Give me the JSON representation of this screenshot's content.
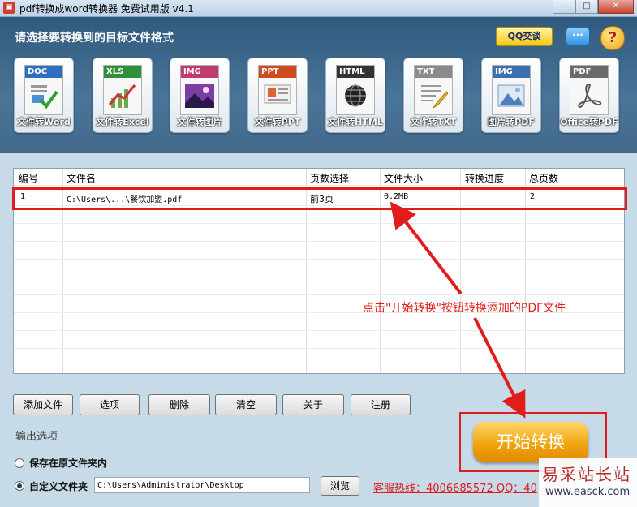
{
  "window": {
    "title": "pdf转换成word转换器 免费试用版 v4.1",
    "controls": [
      "—",
      "□",
      "✕"
    ]
  },
  "header": {
    "prompt": "请选择要转换到的目标文件格式",
    "qq_button": "QQ交谈",
    "chat_icon": "chat-bubble-icon",
    "help_icon": "help-question-icon"
  },
  "formats": [
    {
      "tag": "DOC",
      "label": "文件转Word",
      "tag_color": "#2f6fc2"
    },
    {
      "tag": "XLS",
      "label": "文件转Excel",
      "tag_color": "#2f8f3a"
    },
    {
      "tag": "IMG",
      "label": "文件转图片",
      "tag_color": "#c23b6e"
    },
    {
      "tag": "PPT",
      "label": "文件转PPT",
      "tag_color": "#d04a1f"
    },
    {
      "tag": "HTML",
      "label": "文件转HTML",
      "tag_color": "#333333"
    },
    {
      "tag": "TXT",
      "label": "文件转TXT",
      "tag_color": "#8a8a8a"
    },
    {
      "tag": "IMG",
      "label": "图片转PDF",
      "tag_color": "#3a6fb0"
    },
    {
      "tag": "PDF",
      "label": "Office转PDF",
      "tag_color": "#6a6a6a"
    }
  ],
  "table": {
    "columns": [
      "编号",
      "文件名",
      "页数选择",
      "文件大小",
      "转换进度",
      "总页数"
    ],
    "rows": [
      {
        "no": "1",
        "file": "C:\\Users\\...\\餐饮加盟.pdf",
        "pages_sel": "前3页",
        "size": "0.2MB",
        "progress": "",
        "total": "2"
      }
    ]
  },
  "annotation": "点击\"开始转换\"按钮转换添加的PDF文件",
  "buttons": {
    "add": "添加文件",
    "options": "选项",
    "delete": "删除",
    "clear": "清空",
    "about": "关于",
    "register": "注册"
  },
  "output": {
    "section_label": "输出选项",
    "option_original": "保存在原文件夹内",
    "option_custom": "自定义文件夹",
    "selected": "custom",
    "path": "C:\\Users\\Administrator\\Desktop",
    "browse": "浏览"
  },
  "hotline": "客服热线：4006685572 QQ：40",
  "start_button": "开始转换",
  "watermark": {
    "title": "易采站长站",
    "url": "www.easck.com"
  }
}
